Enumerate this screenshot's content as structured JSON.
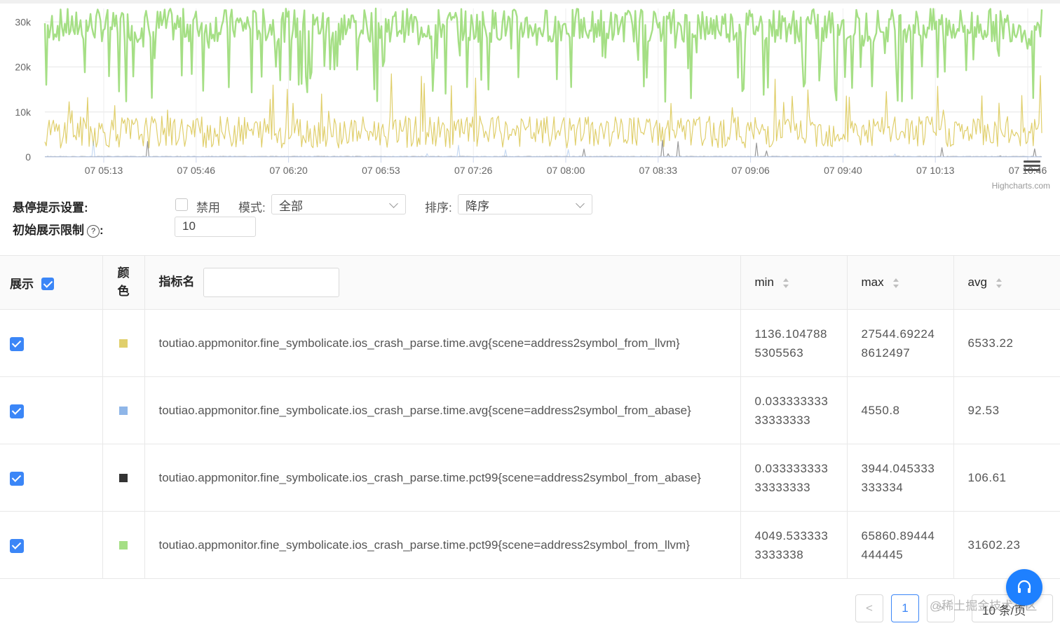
{
  "chart_data": {
    "type": "line",
    "title": "",
    "xlabel": "",
    "ylabel": "",
    "ylim": [
      0,
      33000
    ],
    "y_ticks": [
      "0",
      "10k",
      "20k",
      "30k"
    ],
    "y_tick_values": [
      0,
      10000,
      20000,
      30000
    ],
    "x_ticks": [
      "07 05:13",
      "07 05:46",
      "07 06:20",
      "07 06:53",
      "07 07:26",
      "07 08:00",
      "07 08:33",
      "07 09:06",
      "07 09:40",
      "07 10:13",
      "07 10:46"
    ],
    "grid": true,
    "legend": "none",
    "series_levels": [
      {
        "metric_index": 3,
        "color": "#a5df85",
        "typical": 28500,
        "low": 12000,
        "high": 33000
      },
      {
        "metric_index": 0,
        "color": "#e0cf6c",
        "typical": 6500,
        "low": 2000,
        "high": 19000
      },
      {
        "metric_index": 2,
        "color": "#333333",
        "typical": 110,
        "low": 30,
        "high": 3900
      },
      {
        "metric_index": 1,
        "color": "#8fb6e8",
        "typical": 90,
        "low": 30,
        "high": 4500
      }
    ],
    "credits": "Highcharts.com"
  },
  "controls": {
    "tooltip_label": "悬停提示设置:",
    "disable_label": "禁用",
    "mode_label": "模式:",
    "mode_value": "全部",
    "sort_label": "排序:",
    "sort_value": "降序",
    "limit_label": "初始展示限制",
    "limit_suffix": ":",
    "help_glyph": "?",
    "limit_value": "10"
  },
  "table": {
    "headers": {
      "show": "展示",
      "color_1": "颜",
      "color_2": "色",
      "name": "指标名",
      "min": "min",
      "max": "max",
      "avg": "avg"
    },
    "rows": [
      {
        "name": "toutiao.appmonitor.fine_symbolicate.ios_crash_parse.time.avg{scene=address2symbol_from_llvm}",
        "color": "#e0cf6c",
        "min": "1136.1047885305563",
        "max": "27544.692248612497",
        "avg": "6533.22"
      },
      {
        "name": "toutiao.appmonitor.fine_symbolicate.ios_crash_parse.time.avg{scene=address2symbol_from_abase}",
        "color": "#8fb6e8",
        "min": "0.03333333333333333",
        "max": "4550.8",
        "avg": "92.53"
      },
      {
        "name": "toutiao.appmonitor.fine_symbolicate.ios_crash_parse.time.pct99{scene=address2symbol_from_abase}",
        "color": "#333333",
        "min": "0.03333333333333333",
        "max": "3944.045333333334",
        "avg": "106.61"
      },
      {
        "name": "toutiao.appmonitor.fine_symbolicate.ios_crash_parse.time.pct99{scene=address2symbol_from_llvm}",
        "color": "#a5df85",
        "min": "4049.5333333333338",
        "max": "65860.89444444445",
        "avg": "31602.23"
      }
    ]
  },
  "pagination": {
    "prev": "<",
    "current": "1",
    "next": ">",
    "page_size": "10 条/页"
  },
  "watermark": "@稀土掘金技术社区",
  "theme": {
    "accent": "#3b86f7",
    "float_button": "#1e80ff"
  }
}
